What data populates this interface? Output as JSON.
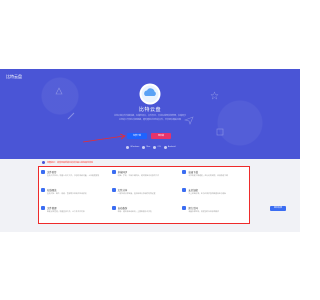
{
  "app_name": "比特云盘",
  "hero": {
    "title": "比特云盘",
    "desc_lines": [
      "比特云盘文件传输快捷，存储空间大，文件安全，支持在线预览和管理，多端同步",
      "让您的工作和生活更便捷，随时随地访问你的文件，分享更多精彩内容"
    ],
    "download_label": "免费下载",
    "web_label": "网页版",
    "platforms": [
      "Windows",
      "Mac",
      "iOS",
      "Android"
    ]
  },
  "notice": "温馨提示：请使用最新版本的浏览器以获得最佳体验",
  "features": [
    {
      "icon": "cloud-upload-icon",
      "title": "文件秒传",
      "desc": "支持文件秒传，快速上传大文件，节省时间和流量，上传速度更快"
    },
    {
      "icon": "sync-icon",
      "title": "多端同步",
      "desc": "电脑、手机、平板多端同步，随时随地访问您的文件"
    },
    {
      "icon": "wifi-icon",
      "title": "高速下载",
      "desc": "专享高速下载通道，充分利用带宽，告别龟速下载"
    },
    {
      "icon": "preview-icon",
      "title": "在线预览",
      "desc": "支持文档、图片、视频、音频等多种格式在线预览"
    },
    {
      "icon": "share-icon",
      "title": "文件分享",
      "desc": "一键生成分享链接，支持加密分享和有效期设置"
    },
    {
      "icon": "lock-icon",
      "title": "安全加密",
      "desc": "多重加密存储，全方位保护您的数据安全与隐私"
    },
    {
      "icon": "folder-icon",
      "title": "文件管理",
      "desc": "智能分类管理，快速查找文件，让文件井井有条"
    },
    {
      "icon": "backup-icon",
      "title": "自动备份",
      "desc": "相册、通讯录自动备份，重要数据永不丢失"
    },
    {
      "icon": "space-icon",
      "title": "超大空间",
      "desc": "海量存储空间，满足您的各种存储需求"
    }
  ],
  "feedback_label": "意见反馈",
  "colors": {
    "brand": "#4a55d6",
    "accent": "#3b6df2",
    "highlight": "#ee2b2b"
  }
}
